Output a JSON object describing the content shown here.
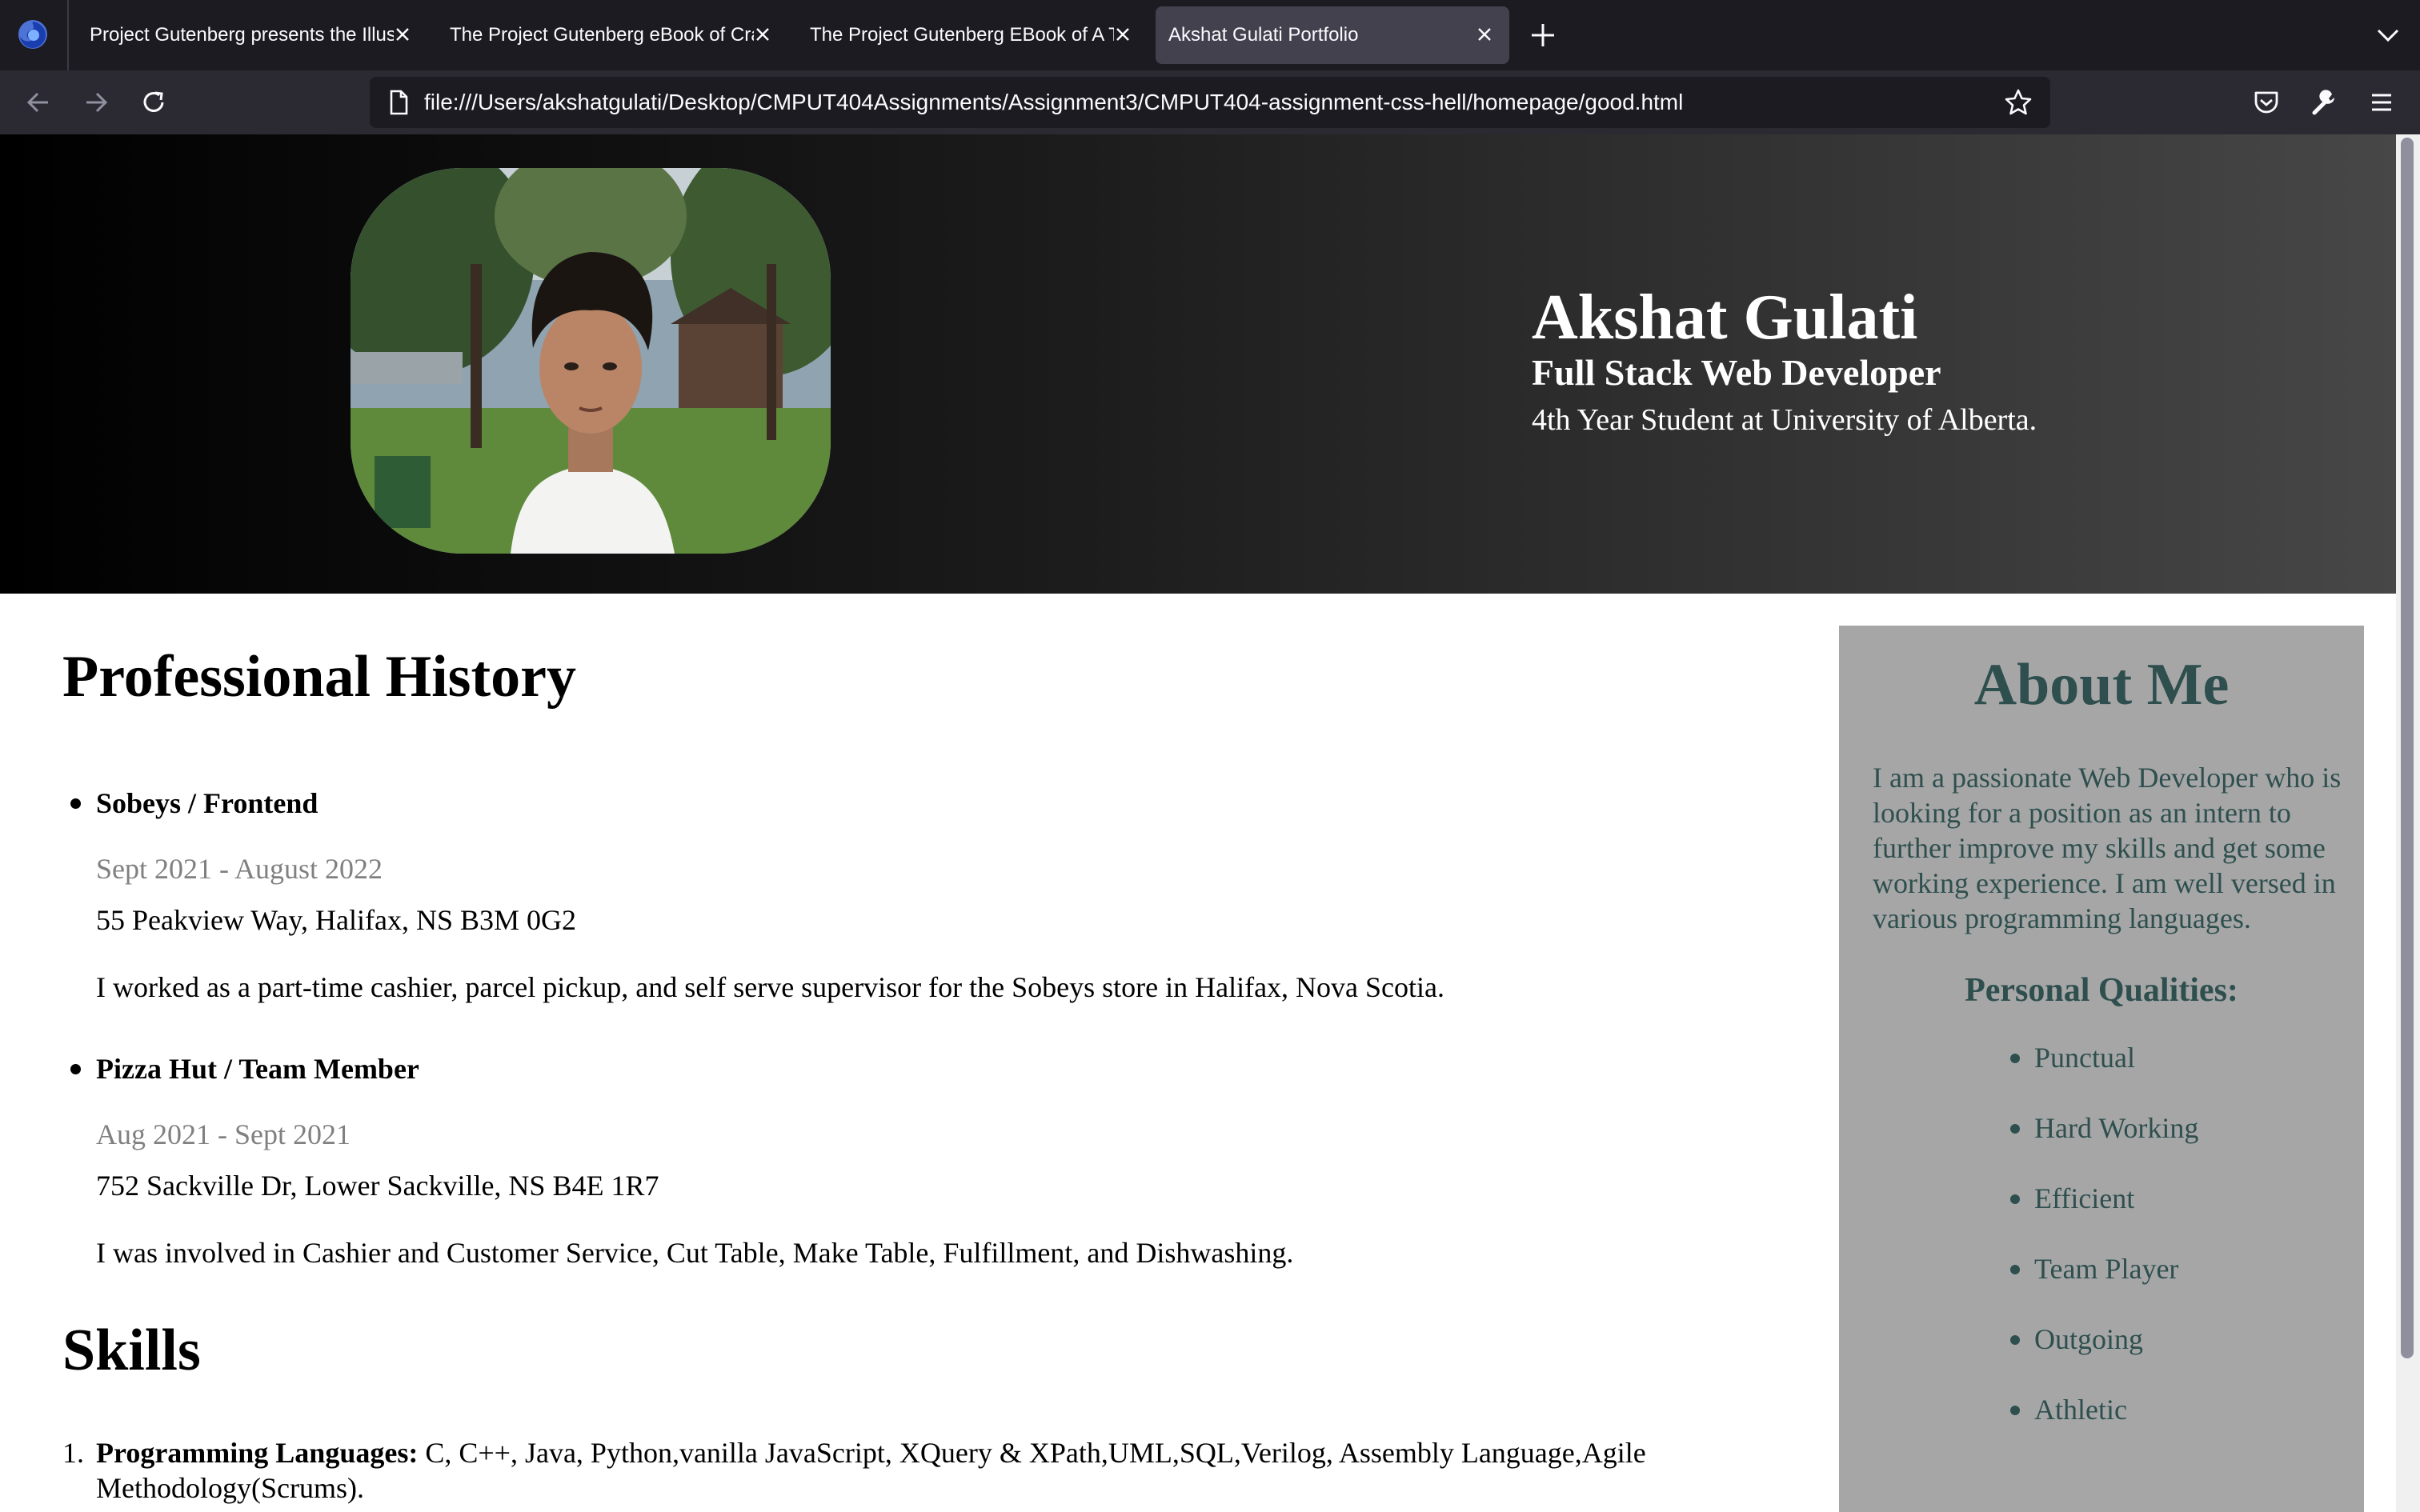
{
  "browser": {
    "tabs": [
      {
        "title": "Project Gutenberg presents the Illus",
        "active": false
      },
      {
        "title": "The Project Gutenberg eBook of Cra",
        "active": false
      },
      {
        "title": "The Project Gutenberg EBook of A T",
        "active": false
      },
      {
        "title": "Akshat Gulati Portfolio",
        "active": true
      }
    ],
    "url": "file:///Users/akshatgulati/Desktop/CMPUT404Assignments/Assignment3/CMPUT404-assignment-css-hell/homepage/good.html",
    "colors": {
      "tabbar": "#1c1b22",
      "navbar": "#2b2a33",
      "text": "#fbfbfe"
    }
  },
  "hero": {
    "name": "Akshat Gulati",
    "role": "Full Stack Web Developer",
    "subtitle": "4th Year Student at University of Alberta."
  },
  "main": {
    "history_heading": "Professional History",
    "jobs": [
      {
        "title": "Sobeys / Frontend",
        "dates": "Sept 2021 - August 2022",
        "address": "55 Peakview Way, Halifax, NS B3M 0G2",
        "description": "I worked as a part-time cashier, parcel pickup, and self serve supervisor for the Sobeys store in Halifax, Nova Scotia."
      },
      {
        "title": "Pizza Hut / Team Member",
        "dates": "Aug 2021 - Sept 2021",
        "address": "752 Sackville Dr, Lower Sackville, NS B4E 1R7",
        "description": "I was involved in Cashier and Customer Service, Cut Table, Make Table, Fulfillment, and Dishwashing."
      }
    ],
    "skills_heading": "Skills",
    "skills": [
      {
        "number": "1.",
        "label": "Programming Languages:",
        "value": " C, C++, Java, Python,vanilla JavaScript, XQuery & XPath,UML,SQL,Verilog, Assembly Language,Agile Methodology(Scrums)."
      }
    ]
  },
  "about": {
    "heading": "About Me",
    "text": "I am a passionate Web Developer who is looking for a position as an intern to further improve my skills and get some working experience. I am well versed in various programming languages.",
    "qualities_heading": "Personal Qualities:",
    "qualities": [
      "Punctual",
      "Hard Working",
      "Efficient",
      "Team Player",
      "Outgoing",
      "Athletic"
    ],
    "colors": {
      "background": "#a6a6a6",
      "text": "#2f4f4f"
    }
  }
}
